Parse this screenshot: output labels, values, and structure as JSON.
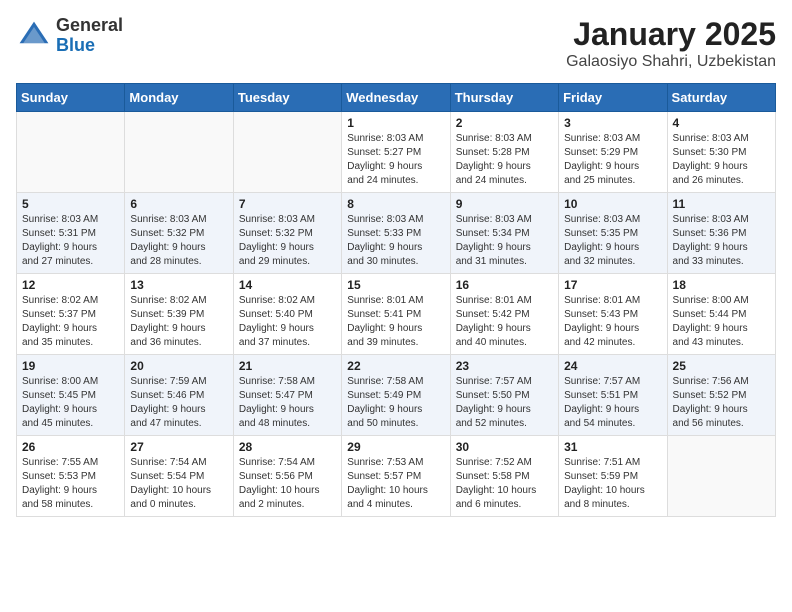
{
  "header": {
    "logo_general": "General",
    "logo_blue": "Blue",
    "title": "January 2025",
    "subtitle": "Galaosiyo Shahri, Uzbekistan"
  },
  "days_of_week": [
    "Sunday",
    "Monday",
    "Tuesday",
    "Wednesday",
    "Thursday",
    "Friday",
    "Saturday"
  ],
  "weeks": [
    [
      {
        "day": "",
        "info": ""
      },
      {
        "day": "",
        "info": ""
      },
      {
        "day": "",
        "info": ""
      },
      {
        "day": "1",
        "info": "Sunrise: 8:03 AM\nSunset: 5:27 PM\nDaylight: 9 hours\nand 24 minutes."
      },
      {
        "day": "2",
        "info": "Sunrise: 8:03 AM\nSunset: 5:28 PM\nDaylight: 9 hours\nand 24 minutes."
      },
      {
        "day": "3",
        "info": "Sunrise: 8:03 AM\nSunset: 5:29 PM\nDaylight: 9 hours\nand 25 minutes."
      },
      {
        "day": "4",
        "info": "Sunrise: 8:03 AM\nSunset: 5:30 PM\nDaylight: 9 hours\nand 26 minutes."
      }
    ],
    [
      {
        "day": "5",
        "info": "Sunrise: 8:03 AM\nSunset: 5:31 PM\nDaylight: 9 hours\nand 27 minutes."
      },
      {
        "day": "6",
        "info": "Sunrise: 8:03 AM\nSunset: 5:32 PM\nDaylight: 9 hours\nand 28 minutes."
      },
      {
        "day": "7",
        "info": "Sunrise: 8:03 AM\nSunset: 5:32 PM\nDaylight: 9 hours\nand 29 minutes."
      },
      {
        "day": "8",
        "info": "Sunrise: 8:03 AM\nSunset: 5:33 PM\nDaylight: 9 hours\nand 30 minutes."
      },
      {
        "day": "9",
        "info": "Sunrise: 8:03 AM\nSunset: 5:34 PM\nDaylight: 9 hours\nand 31 minutes."
      },
      {
        "day": "10",
        "info": "Sunrise: 8:03 AM\nSunset: 5:35 PM\nDaylight: 9 hours\nand 32 minutes."
      },
      {
        "day": "11",
        "info": "Sunrise: 8:03 AM\nSunset: 5:36 PM\nDaylight: 9 hours\nand 33 minutes."
      }
    ],
    [
      {
        "day": "12",
        "info": "Sunrise: 8:02 AM\nSunset: 5:37 PM\nDaylight: 9 hours\nand 35 minutes."
      },
      {
        "day": "13",
        "info": "Sunrise: 8:02 AM\nSunset: 5:39 PM\nDaylight: 9 hours\nand 36 minutes."
      },
      {
        "day": "14",
        "info": "Sunrise: 8:02 AM\nSunset: 5:40 PM\nDaylight: 9 hours\nand 37 minutes."
      },
      {
        "day": "15",
        "info": "Sunrise: 8:01 AM\nSunset: 5:41 PM\nDaylight: 9 hours\nand 39 minutes."
      },
      {
        "day": "16",
        "info": "Sunrise: 8:01 AM\nSunset: 5:42 PM\nDaylight: 9 hours\nand 40 minutes."
      },
      {
        "day": "17",
        "info": "Sunrise: 8:01 AM\nSunset: 5:43 PM\nDaylight: 9 hours\nand 42 minutes."
      },
      {
        "day": "18",
        "info": "Sunrise: 8:00 AM\nSunset: 5:44 PM\nDaylight: 9 hours\nand 43 minutes."
      }
    ],
    [
      {
        "day": "19",
        "info": "Sunrise: 8:00 AM\nSunset: 5:45 PM\nDaylight: 9 hours\nand 45 minutes."
      },
      {
        "day": "20",
        "info": "Sunrise: 7:59 AM\nSunset: 5:46 PM\nDaylight: 9 hours\nand 47 minutes."
      },
      {
        "day": "21",
        "info": "Sunrise: 7:58 AM\nSunset: 5:47 PM\nDaylight: 9 hours\nand 48 minutes."
      },
      {
        "day": "22",
        "info": "Sunrise: 7:58 AM\nSunset: 5:49 PM\nDaylight: 9 hours\nand 50 minutes."
      },
      {
        "day": "23",
        "info": "Sunrise: 7:57 AM\nSunset: 5:50 PM\nDaylight: 9 hours\nand 52 minutes."
      },
      {
        "day": "24",
        "info": "Sunrise: 7:57 AM\nSunset: 5:51 PM\nDaylight: 9 hours\nand 54 minutes."
      },
      {
        "day": "25",
        "info": "Sunrise: 7:56 AM\nSunset: 5:52 PM\nDaylight: 9 hours\nand 56 minutes."
      }
    ],
    [
      {
        "day": "26",
        "info": "Sunrise: 7:55 AM\nSunset: 5:53 PM\nDaylight: 9 hours\nand 58 minutes."
      },
      {
        "day": "27",
        "info": "Sunrise: 7:54 AM\nSunset: 5:54 PM\nDaylight: 10 hours\nand 0 minutes."
      },
      {
        "day": "28",
        "info": "Sunrise: 7:54 AM\nSunset: 5:56 PM\nDaylight: 10 hours\nand 2 minutes."
      },
      {
        "day": "29",
        "info": "Sunrise: 7:53 AM\nSunset: 5:57 PM\nDaylight: 10 hours\nand 4 minutes."
      },
      {
        "day": "30",
        "info": "Sunrise: 7:52 AM\nSunset: 5:58 PM\nDaylight: 10 hours\nand 6 minutes."
      },
      {
        "day": "31",
        "info": "Sunrise: 7:51 AM\nSunset: 5:59 PM\nDaylight: 10 hours\nand 8 minutes."
      },
      {
        "day": "",
        "info": ""
      }
    ]
  ]
}
